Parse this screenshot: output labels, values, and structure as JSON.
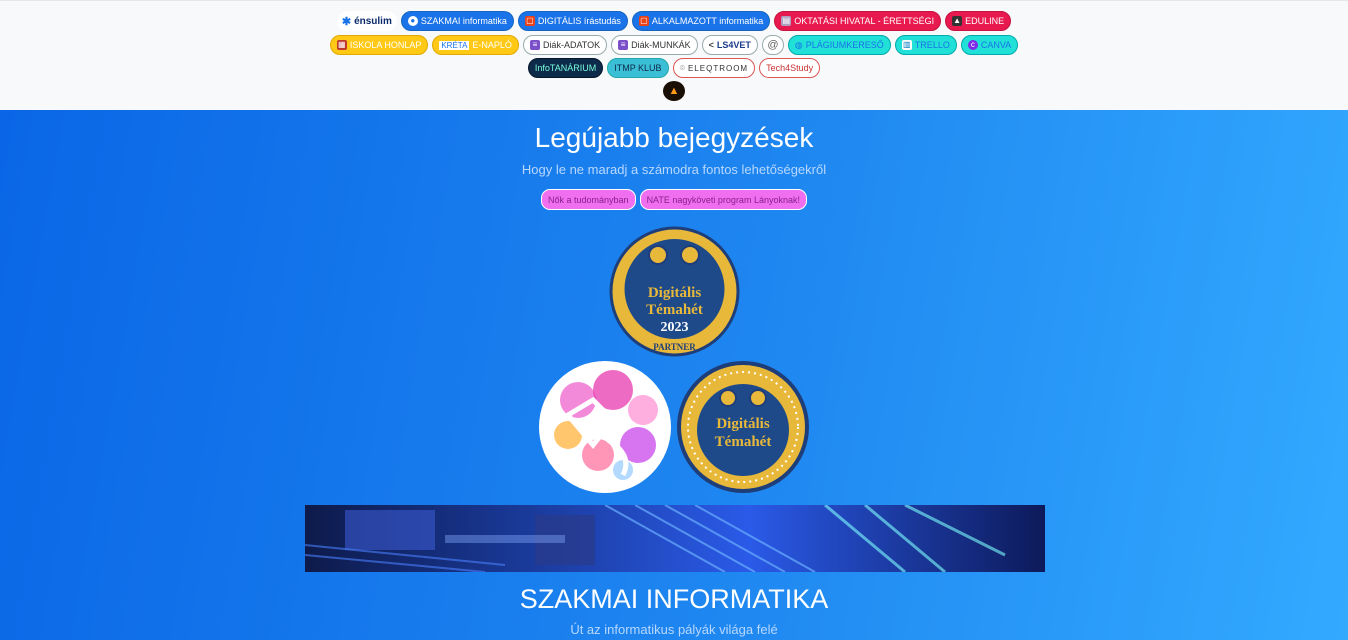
{
  "nav": {
    "row1": [
      {
        "label": "énsulim",
        "icon": "ensulim-logo"
      },
      {
        "label": "SZAKMAI informatika",
        "icon": "bulb-icon"
      },
      {
        "label": "DIGITÁLIS írástudás",
        "icon": "office-icon"
      },
      {
        "label": "ALKALMAZOTT informatika",
        "icon": "office-icon"
      },
      {
        "label": "OKTATÁSI HIVATAL - ÉRETTSÉGI",
        "icon": "books-icon"
      },
      {
        "label": "EDULINE",
        "icon": "graduation-icon"
      }
    ],
    "row2": [
      {
        "label": "ISKOLA HONLAP",
        "icon": "school-icon"
      },
      {
        "label": "E-NAPLÓ",
        "icon": "kreta-logo"
      },
      {
        "label": "Diák-ADATOK",
        "icon": "document-icon"
      },
      {
        "label": "Diák-MUNKÁK",
        "icon": "document-icon"
      },
      {
        "label": "LS4VET",
        "icon": "share-icon"
      },
      {
        "label": "",
        "icon": "swirl-icon"
      },
      {
        "label": "PLÁGIUMKERESŐ",
        "icon": "globe-icon"
      },
      {
        "label": "TRELLO",
        "icon": "trello-icon"
      },
      {
        "label": "CANVA",
        "icon": "canva-icon"
      }
    ],
    "row3": [
      {
        "label": "InfoTANÁRIUM",
        "icon": ""
      },
      {
        "label": "ITMP KLUB",
        "icon": ""
      },
      {
        "label": "ELEQTROOM",
        "icon": "location-pin-icon"
      },
      {
        "label": "Tech4Study",
        "icon": ""
      }
    ]
  },
  "hero": {
    "title": "Legújabb bejegyzések",
    "subtitle": "Hogy le ne maradj a számodra fontos lehetőségekről",
    "tags": [
      "Nők a tudományban",
      "NATE nagyköveti program Lányoknak!"
    ],
    "badge_big": {
      "line1": "Digitális",
      "line2": "Témahét",
      "line3": "2023",
      "ribbon": "PARTNER"
    },
    "badge_b": {
      "line1": "Digitális",
      "line2": "Témahét"
    }
  },
  "section": {
    "title": "SZAKMAI INFORMATIKA",
    "subtitle": "Út az informatikus pályák világa felé"
  }
}
